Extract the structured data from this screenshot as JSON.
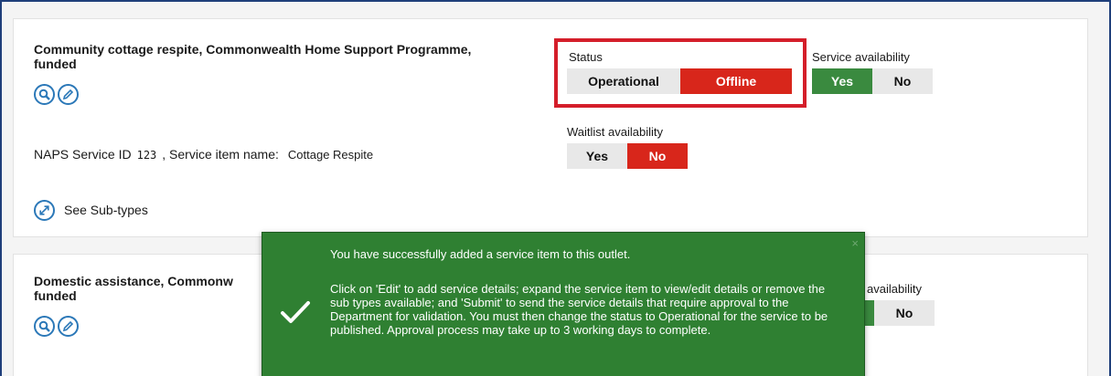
{
  "item1": {
    "title": "Community cottage respite, Commonwealth Home Support Programme, funded",
    "naps_label": "NAPS Service ID",
    "naps_id": "123",
    "sep": ", Service item name:",
    "service_item_name": "Cottage Respite",
    "sub_types_link": "See Sub-types",
    "status": {
      "label": "Status",
      "options": [
        "Operational",
        "Offline"
      ],
      "selected": "Offline"
    },
    "service_availability": {
      "label": "Service availability",
      "options": [
        "Yes",
        "No"
      ],
      "selected": "Yes"
    },
    "waitlist_availability": {
      "label": "Waitlist availability",
      "options": [
        "Yes",
        "No"
      ],
      "selected": "No"
    }
  },
  "item2": {
    "title_line1": "Domestic assistance, Commonw",
    "title_line2": "funded",
    "service_availability_partial_label": "availability",
    "service_availability_no": "No"
  },
  "toast": {
    "message_line1": "You have successfully added a service item to this outlet.",
    "message_line2": "Click on 'Edit' to add service details; expand the service item to view/edit details or remove the sub types available; and 'Submit' to send the service details that require approval to the Department for validation. You must then change the status to Operational for the service to be published. Approval process may take up to 3 working days to complete.",
    "close_glyph": "×"
  },
  "colors": {
    "accent_red": "#d8261b",
    "accent_green": "#3a8a3f",
    "toast_green": "#2f8032",
    "highlight_box": "#d41e2a",
    "icon_blue": "#2b78b8"
  },
  "icons": [
    "search-icon",
    "edit-pencil-icon",
    "expand-icon",
    "checkmark-icon"
  ]
}
